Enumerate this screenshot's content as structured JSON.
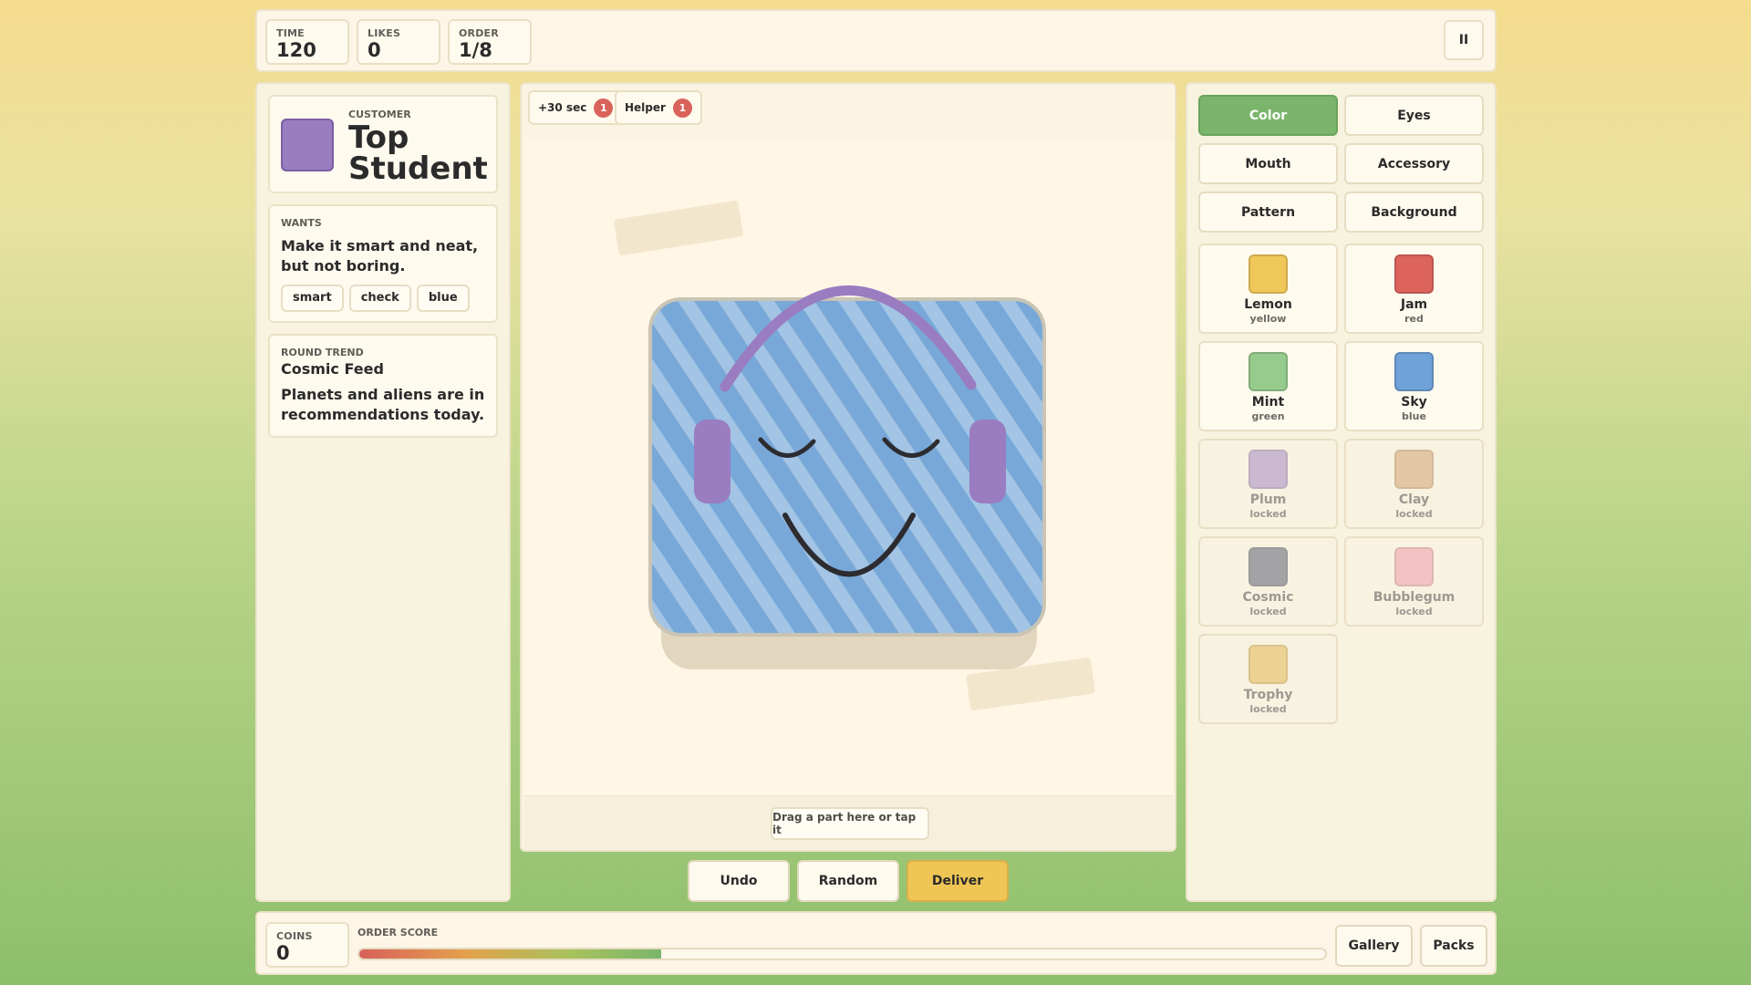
{
  "hud": {
    "time_label": "TIME",
    "time_value": "120",
    "likes_label": "LIKES",
    "likes_value": "0",
    "order_label": "ORDER",
    "order_value": "1/8",
    "pause_label": "II"
  },
  "customer": {
    "label": "CUSTOMER",
    "name_line1": "Top",
    "name_line2": "Student",
    "color": "#9a7cc1"
  },
  "wants": {
    "label": "WANTS",
    "text": "Make it smart and neat, but not boring.",
    "tags": [
      "smart",
      "check",
      "blue"
    ]
  },
  "trend": {
    "label": "ROUND TREND",
    "name": "Cosmic Feed",
    "text": "Planets and aliens are in recommendations today."
  },
  "powerups": [
    {
      "label": "+30 sec",
      "count": "1"
    },
    {
      "label": "Helper",
      "count": "1"
    }
  ],
  "creature": {
    "body_color": "#78a8d8",
    "pattern": "stripes",
    "accessory": "headphones",
    "accessory_color": "#9a7cc1",
    "eyes": "closed-happy",
    "mouth": "smile"
  },
  "drop_hint": "Drag a part here or tap it",
  "actions": {
    "undo": "Undo",
    "random": "Random",
    "deliver": "Deliver"
  },
  "categories": [
    {
      "label": "Color",
      "active": true
    },
    {
      "label": "Eyes",
      "active": false
    },
    {
      "label": "Mouth",
      "active": false
    },
    {
      "label": "Accessory",
      "active": false
    },
    {
      "label": "Pattern",
      "active": false
    },
    {
      "label": "Background",
      "active": false
    }
  ],
  "colors": [
    {
      "name": "Lemon",
      "sub": "yellow",
      "hex": "#f0c85a",
      "locked": false
    },
    {
      "name": "Jam",
      "sub": "red",
      "hex": "#dc645c",
      "locked": false
    },
    {
      "name": "Mint",
      "sub": "green",
      "hex": "#97cb8d",
      "locked": false
    },
    {
      "name": "Sky",
      "sub": "blue",
      "hex": "#6fa2d8",
      "locked": false
    },
    {
      "name": "Plum",
      "sub": "locked",
      "hex": "#a58bc4",
      "locked": true
    },
    {
      "name": "Clay",
      "sub": "locked",
      "hex": "#d4a474",
      "locked": true
    },
    {
      "name": "Cosmic",
      "sub": "locked",
      "hex": "#5f6378",
      "locked": true
    },
    {
      "name": "Bubblegum",
      "sub": "locked",
      "hex": "#ee9eab",
      "locked": true
    },
    {
      "name": "Trophy",
      "sub": "locked",
      "hex": "#e4b856",
      "locked": true
    }
  ],
  "footer": {
    "coins_label": "COINS",
    "coins_value": "0",
    "score_label": "ORDER SCORE",
    "score_fraction": 0.313,
    "gallery": "Gallery",
    "packs": "Packs"
  }
}
